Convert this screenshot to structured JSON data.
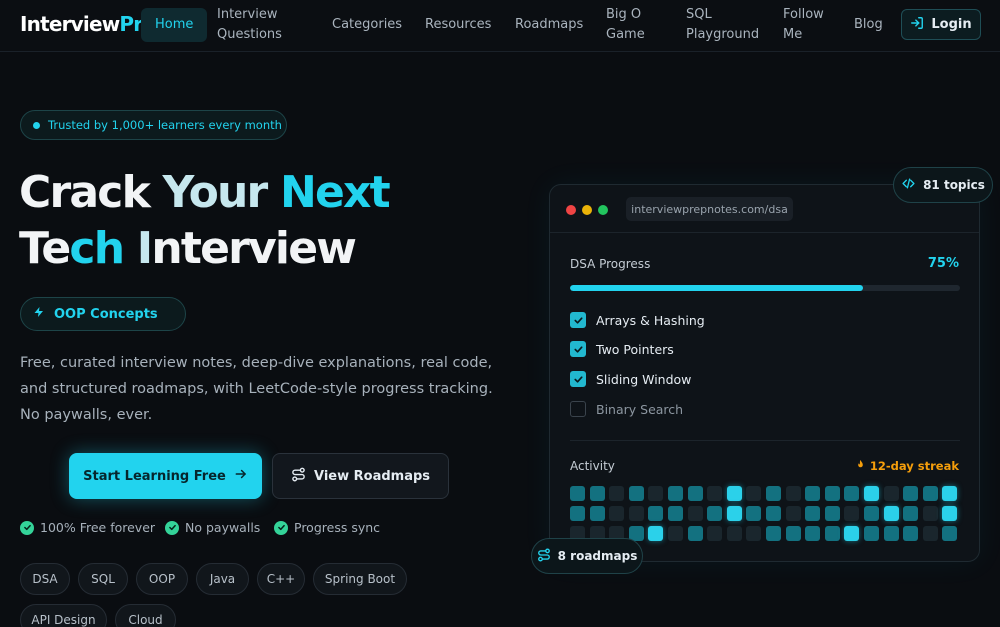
{
  "nav": {
    "brand_part1": "Interview",
    "brand_part2": "Prep",
    "items": [
      {
        "label": "Home"
      },
      {
        "label": "Interview\nQuestions"
      },
      {
        "label": "Categories"
      },
      {
        "label": "Resources"
      },
      {
        "label": "Roadmaps"
      },
      {
        "label": "Big O\nGame"
      },
      {
        "label": "SQL\nPlayground"
      },
      {
        "label": "Follow\nMe"
      },
      {
        "label": "Blog"
      }
    ],
    "login_label": "Login",
    "login_icon": "login-icon"
  },
  "hero": {
    "trusted_badge": "Trusted by 1,000+ learners every month",
    "title": {
      "w1": "Crack ",
      "w2": "Your ",
      "w3": "Next",
      "w4a": "Te",
      "w4b": "ch ",
      "w5a": "I",
      "w5b": "nterview"
    },
    "topic_pill": "OOP Concepts",
    "topic_icon": "lightning-icon",
    "description_lines": [
      "Free, curated interview notes, deep-dive explanations, real code,",
      "and structured roadmaps, with LeetCode-style progress tracking.",
      "No paywalls, ever."
    ],
    "primary_button": "Start Learning Free",
    "secondary_button": "View Roadmaps",
    "perks": [
      "100% Free forever",
      "No paywalls",
      "Progress sync"
    ],
    "tags": [
      "DSA",
      "SQL",
      "OOP",
      "Java",
      "C++",
      "Spring Boot",
      "API Design",
      "Cloud"
    ]
  },
  "card": {
    "url": "interviewprepnotes.com/dsa",
    "progress_label": "DSA Progress",
    "progress_percent_text": "75%",
    "progress_fraction": 0.75,
    "checklist": [
      {
        "label": "Arrays & Hashing",
        "checked": true
      },
      {
        "label": "Two Pointers",
        "checked": true
      },
      {
        "label": "Sliding Window",
        "checked": true
      },
      {
        "label": "Binary Search",
        "checked": false
      }
    ],
    "activity_label": "Activity",
    "streak": "12-day streak",
    "activity_levels": [
      [
        2,
        2,
        1,
        2,
        1,
        2,
        2,
        1,
        3,
        1,
        2,
        1,
        2,
        2,
        2,
        3,
        1,
        2,
        2,
        3
      ],
      [
        2,
        2,
        1,
        1,
        2,
        2,
        1,
        2,
        3,
        2,
        2,
        1,
        2,
        2,
        1,
        2,
        3,
        2,
        1,
        3
      ],
      [
        1,
        1,
        1,
        2,
        3,
        1,
        2,
        1,
        1,
        1,
        2,
        2,
        2,
        2,
        3,
        2,
        2,
        2,
        1,
        2
      ]
    ],
    "activity_colors": [
      "#141a20",
      "#1a262d",
      "#137180",
      "#2bd1ea"
    ]
  },
  "floating": {
    "topics": "81 topics",
    "roadmaps": "8 roadmaps"
  },
  "colors": {
    "accent": "#22d3ee",
    "background": "#0a0d11",
    "success": "#34d399",
    "streak": "#f59e0b"
  }
}
